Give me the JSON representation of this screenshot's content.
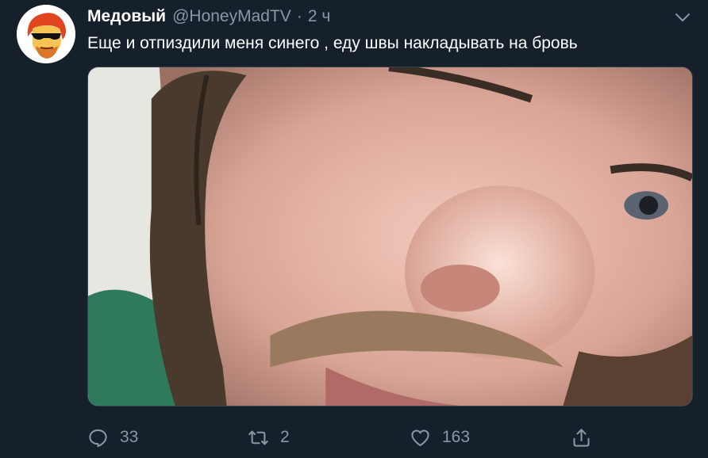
{
  "tweet": {
    "display_name": "Медовый",
    "handle": "@HoneyMadTV",
    "separator": "·",
    "time": "2 ч",
    "text": "Еще и отпиздили меня синего , еду швы накладывать на бровь"
  },
  "actions": {
    "reply_count": "33",
    "retweet_count": "2",
    "like_count": "163"
  },
  "icons": {
    "menu": "chevron-down-icon",
    "reply": "reply-icon",
    "retweet": "retweet-icon",
    "like": "heart-icon",
    "share": "share-icon"
  },
  "colors": {
    "background": "#15202b",
    "secondary_text": "#8899a6",
    "border": "#38444d",
    "primary_text": "#ffffff"
  }
}
